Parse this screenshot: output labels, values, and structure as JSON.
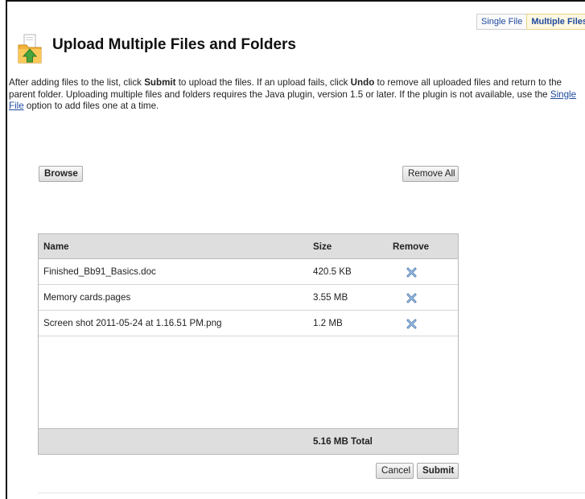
{
  "mode_tabs": [
    {
      "label": "Single File",
      "active": false
    },
    {
      "label": "Multiple Files",
      "active": true
    }
  ],
  "page": {
    "title": "Upload Multiple Files and Folders",
    "title_icon": "folder-upload-icon"
  },
  "instructions": {
    "part1": "After adding files to the list, click ",
    "submit_word": "Submit",
    "part2": " to upload the files. If an upload fails, click ",
    "undo_word": "Undo",
    "part3": " to remove all uploaded files and return to the parent folder. Uploading multiple files and folders requires the Java plugin, version 1.5 or later. If the plugin is not available, use the ",
    "single_file_link": "Single File",
    "part4": " option to add files one at a time."
  },
  "toolbar": {
    "browse_label": "Browse",
    "remove_all_label": "Remove All"
  },
  "table": {
    "columns": {
      "name": "Name",
      "size": "Size",
      "remove": "Remove"
    },
    "rows": [
      {
        "name": "Finished_Bb91_Basics.doc",
        "size": "420.5 KB",
        "remove_icon": "remove-x-icon"
      },
      {
        "name": "Memory cards.pages",
        "size": "3.55 MB",
        "remove_icon": "remove-x-icon"
      },
      {
        "name": "Screen shot 2011-05-24 at 1.16.51 PM.png",
        "size": "1.2 MB",
        "remove_icon": "remove-x-icon"
      }
    ],
    "total": "5.16 MB Total"
  },
  "actions": {
    "cancel_label": "Cancel",
    "submit_label": "Submit"
  },
  "colors": {
    "link": "#1f4aa0",
    "header_gray": "#dedede",
    "active_tab_bg": "#fff8e0",
    "remove_icon": "#5a86b8"
  }
}
